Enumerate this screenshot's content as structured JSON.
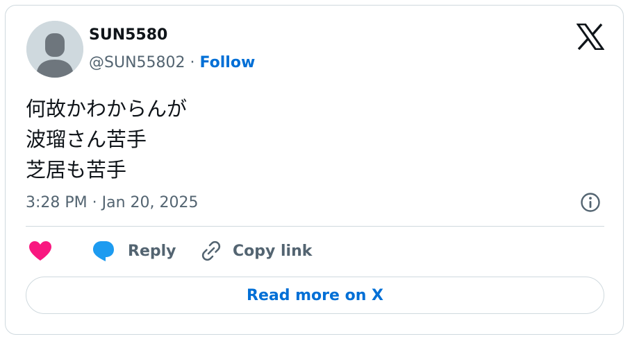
{
  "user": {
    "display_name": "SUN5580",
    "handle": "@SUN55802",
    "separator": "·",
    "follow_label": "Follow"
  },
  "tweet": {
    "lines": [
      "何故かわからんが",
      "波瑠さん苦手",
      "芝居も苦手"
    ],
    "timestamp": "3:28 PM · Jan 20, 2025"
  },
  "actions": {
    "like_icon": "heart-icon",
    "reply_label": "Reply",
    "reply_icon": "speech-bubble-icon",
    "copy_link_label": "Copy link",
    "copy_link_icon": "link-icon"
  },
  "read_more_label": "Read more on X",
  "icons": {
    "brand": "x-logo-icon",
    "info": "info-icon"
  },
  "colors": {
    "link_blue": "#006fd6",
    "like_pink": "#f91880",
    "reply_blue": "#1d9bf0",
    "text_primary": "#0f1419",
    "text_secondary": "#536471",
    "border": "#cfd9de"
  }
}
